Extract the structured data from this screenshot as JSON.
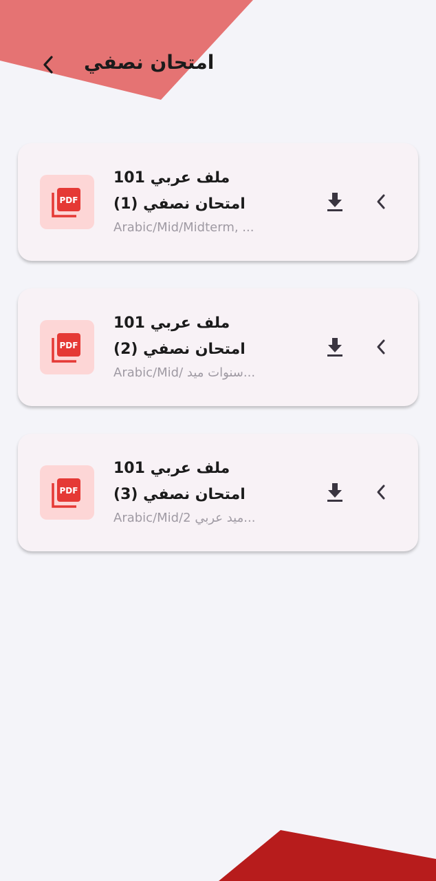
{
  "colors": {
    "background": "#f4f4f9",
    "top_accent": "#e57373",
    "bottom_accent": "#b71c1c",
    "card_bg": "#f8f2f6",
    "pdf_bg": "#fdd6d6",
    "pdf_icon": "#e53935"
  },
  "header": {
    "title": "امتحان نصفي",
    "back_icon": "chevron-left-icon"
  },
  "files": [
    {
      "line1": "ملف عربي 101",
      "line2": "امتحان نصفي (1)",
      "path": "Arabic/Mid/Midterm, ...",
      "icon": "pdf-file-icon"
    },
    {
      "line1": "ملف عربي 101",
      "line2": "امتحان نصفي (2)",
      "path": "Arabic/Mid/ سنوات ميد...",
      "icon": "pdf-file-icon"
    },
    {
      "line1": "ملف عربي 101",
      "line2": "امتحان نصفي (3)",
      "path": "Arabic/Mid/2 ميد عربي...",
      "icon": "pdf-file-icon"
    }
  ]
}
